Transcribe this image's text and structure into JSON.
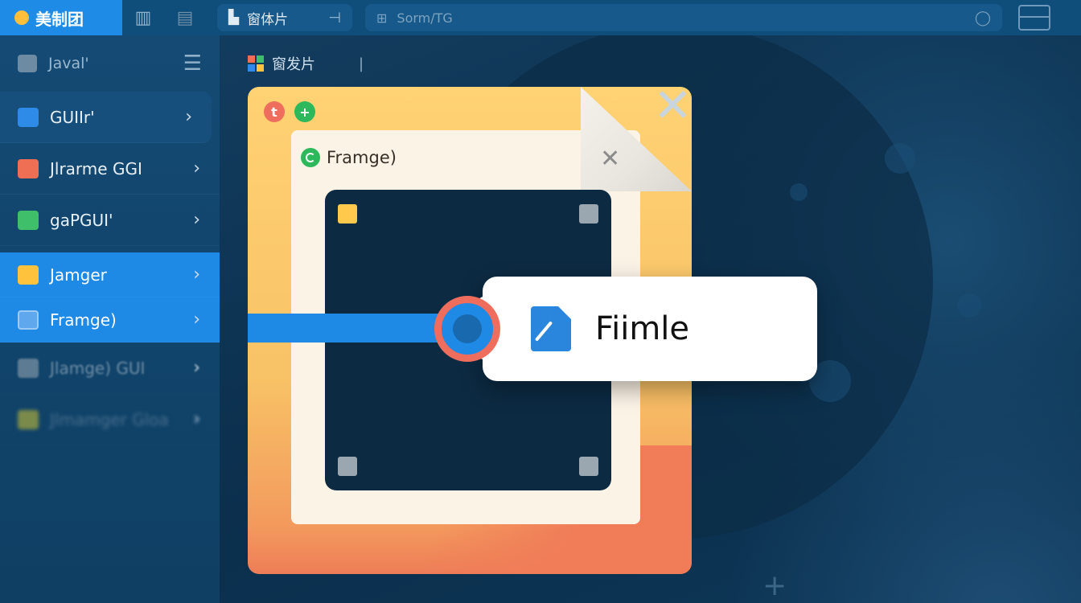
{
  "topbar": {
    "brand": "美制团",
    "tab_label": "窗体片",
    "tab_close": "⊣",
    "search_placeholder": "Sorm/TG"
  },
  "sidebar": {
    "header": "Javal'",
    "items": [
      {
        "label": "GUIIr'",
        "color": "#2f8be8"
      },
      {
        "label": "Jlrarme GGI",
        "color": "#ef6f55"
      },
      {
        "label": "gaPGUI'",
        "color": "#3fbf6a"
      },
      {
        "label": "Jamger",
        "color": "#ffc23d"
      },
      {
        "label": "Framge)",
        "color": "#2f8be8"
      },
      {
        "label": "Jlamge) GUI",
        "color": "#6f8ea6"
      },
      {
        "label": "Jlmamger Gloa",
        "color": "#7a8a4a"
      }
    ]
  },
  "breadcrumb": {
    "title": "窗发片",
    "separator": "|"
  },
  "card": {
    "frame_title": "Framge)",
    "dot_close_symbol": "t",
    "dot_add_symbol": "+"
  },
  "slider": {
    "value": 0.85
  },
  "popup": {
    "text": "Fiimle"
  },
  "colors": {
    "accent": "#1f8ae6",
    "close_red": "#ef6d5c",
    "add_green": "#2db85b",
    "card_yellow": "#ffd274"
  }
}
